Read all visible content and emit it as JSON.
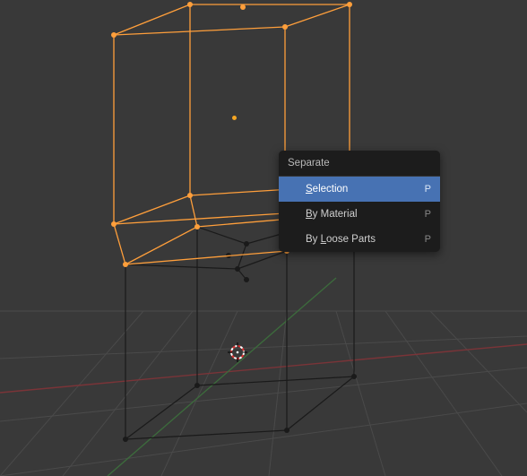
{
  "menu": {
    "title": "Separate",
    "items": [
      {
        "mnemonic": "S",
        "rest": "election",
        "shortcut": "P",
        "highlighted": true
      },
      {
        "mnemonic": "B",
        "rest": "y Material",
        "shortcut": "P",
        "highlighted": false
      },
      {
        "mnemonic": "",
        "rest_pre": "By ",
        "mnemonic2": "L",
        "rest2": "oose Parts",
        "shortcut": "P",
        "highlighted": false
      }
    ]
  },
  "colors": {
    "wire_selected": "#ff9f3b",
    "wire_unselected": "#1a1a1a",
    "vertex_selected": "#ff9f3b",
    "vertex_unselected": "#1a1a1a"
  }
}
